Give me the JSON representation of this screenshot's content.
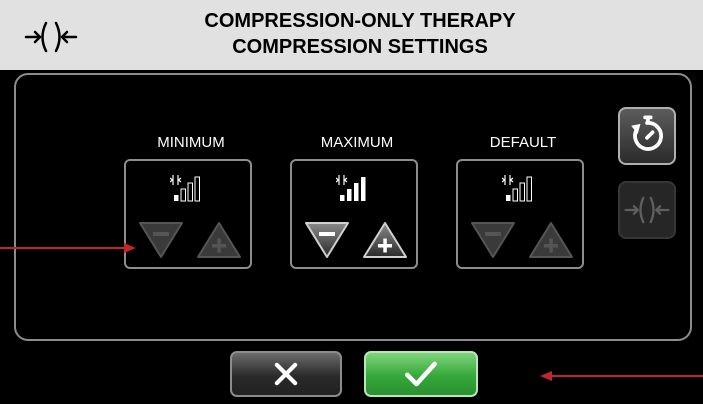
{
  "header": {
    "title_line1": "COMPRESSION-ONLY THERAPY",
    "title_line2": "COMPRESSION SETTINGS",
    "icon": "compression-icon"
  },
  "settings": [
    {
      "label": "MINIMUM",
      "level_bars_filled": 1,
      "decrease_enabled": false,
      "increase_enabled": false
    },
    {
      "label": "MAXIMUM",
      "level_bars_filled": 4,
      "decrease_enabled": true,
      "increase_enabled": true
    },
    {
      "label": "DEFAULT",
      "level_bars_filled": 1,
      "decrease_enabled": false,
      "increase_enabled": false
    }
  ],
  "side_buttons": [
    {
      "icon": "timer-icon",
      "enabled": true
    },
    {
      "icon": "compression-icon",
      "enabled": false
    }
  ],
  "footer": {
    "cancel_icon": "close-icon",
    "confirm_icon": "checkmark-icon"
  },
  "colors": {
    "header_bg": "#e1e1e1",
    "screen_bg": "#000000",
    "confirm": "#35a83a",
    "callout_arrow": "#c0272d"
  }
}
